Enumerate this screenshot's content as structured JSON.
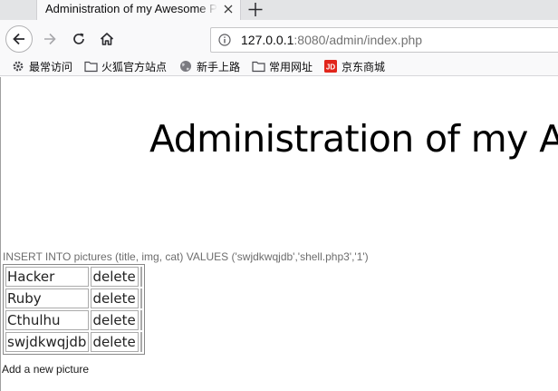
{
  "browser": {
    "tab": {
      "title": "Administration of my Awesome Pictures"
    },
    "url": {
      "host": "127.0.0.1",
      "rest": ":8080/admin/index.php"
    },
    "bookmarks": [
      {
        "label": "最常访问",
        "icon": "gear-icon"
      },
      {
        "label": "火狐官方站点",
        "icon": "folder-icon"
      },
      {
        "label": "新手上路",
        "icon": "globe-icon"
      },
      {
        "label": "常用网址",
        "icon": "folder-icon"
      },
      {
        "label": "京东商城",
        "icon": "jd-logo-icon"
      }
    ]
  },
  "page": {
    "heading": "Administration of my Awesome Pictures",
    "sql_query": "INSERT INTO pictures (title, img, cat) VALUES ('swjdkwqjdb','shell.php3','1')",
    "pictures": [
      {
        "title": "Hacker",
        "action": "delete"
      },
      {
        "title": "Ruby",
        "action": "delete"
      },
      {
        "title": "Cthulhu",
        "action": "delete"
      },
      {
        "title": "swjdkwqjdb",
        "action": "delete"
      }
    ],
    "add_link": "Add a new picture"
  }
}
